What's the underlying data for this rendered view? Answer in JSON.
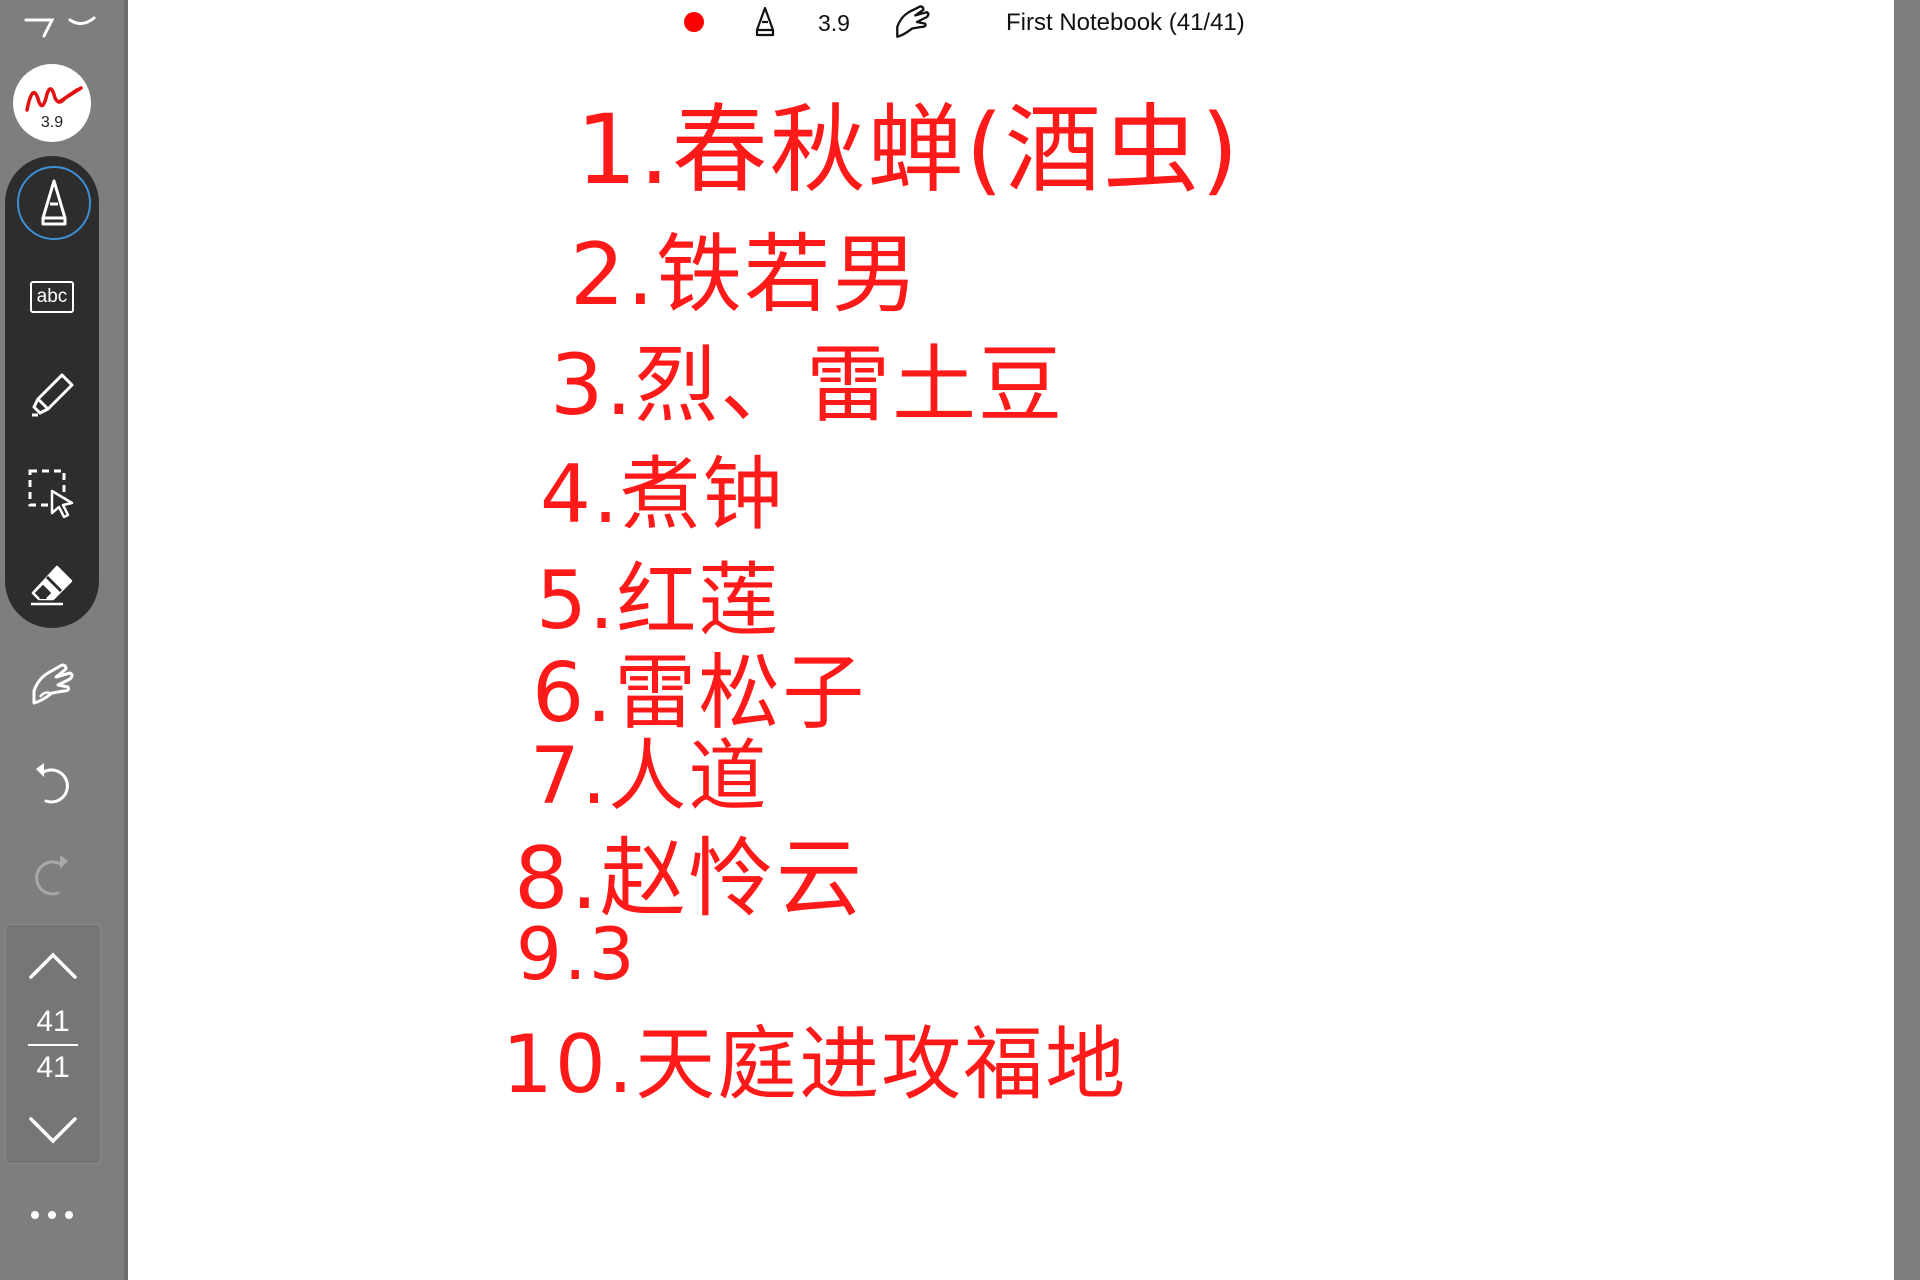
{
  "toolbar": {
    "pen_size": "3.9",
    "ink_color": "#ff1a1a",
    "notebook_title": "First Notebook (41/41)"
  },
  "sidebar": {
    "pen_preview_size": "3.9",
    "icons": [
      "collapse-icon",
      "pen-icon",
      "text-box-icon",
      "highlighter-icon",
      "lasso-select-icon",
      "eraser-icon",
      "finger-draw-icon",
      "undo-icon",
      "redo-icon",
      "page-up-icon",
      "page-down-icon",
      "more-icon"
    ],
    "text_tool_label": "abc",
    "page_current": "41",
    "page_total": "41"
  },
  "notes": [
    "1.春秋蝉(酒虫)",
    "2.铁若男",
    "3.烈、雷土豆",
    "4.煮钟",
    "5.红莲",
    "6.雷松子",
    "7.人道",
    "8.赵怜云",
    "9.3",
    "10.天庭进攻福地"
  ]
}
